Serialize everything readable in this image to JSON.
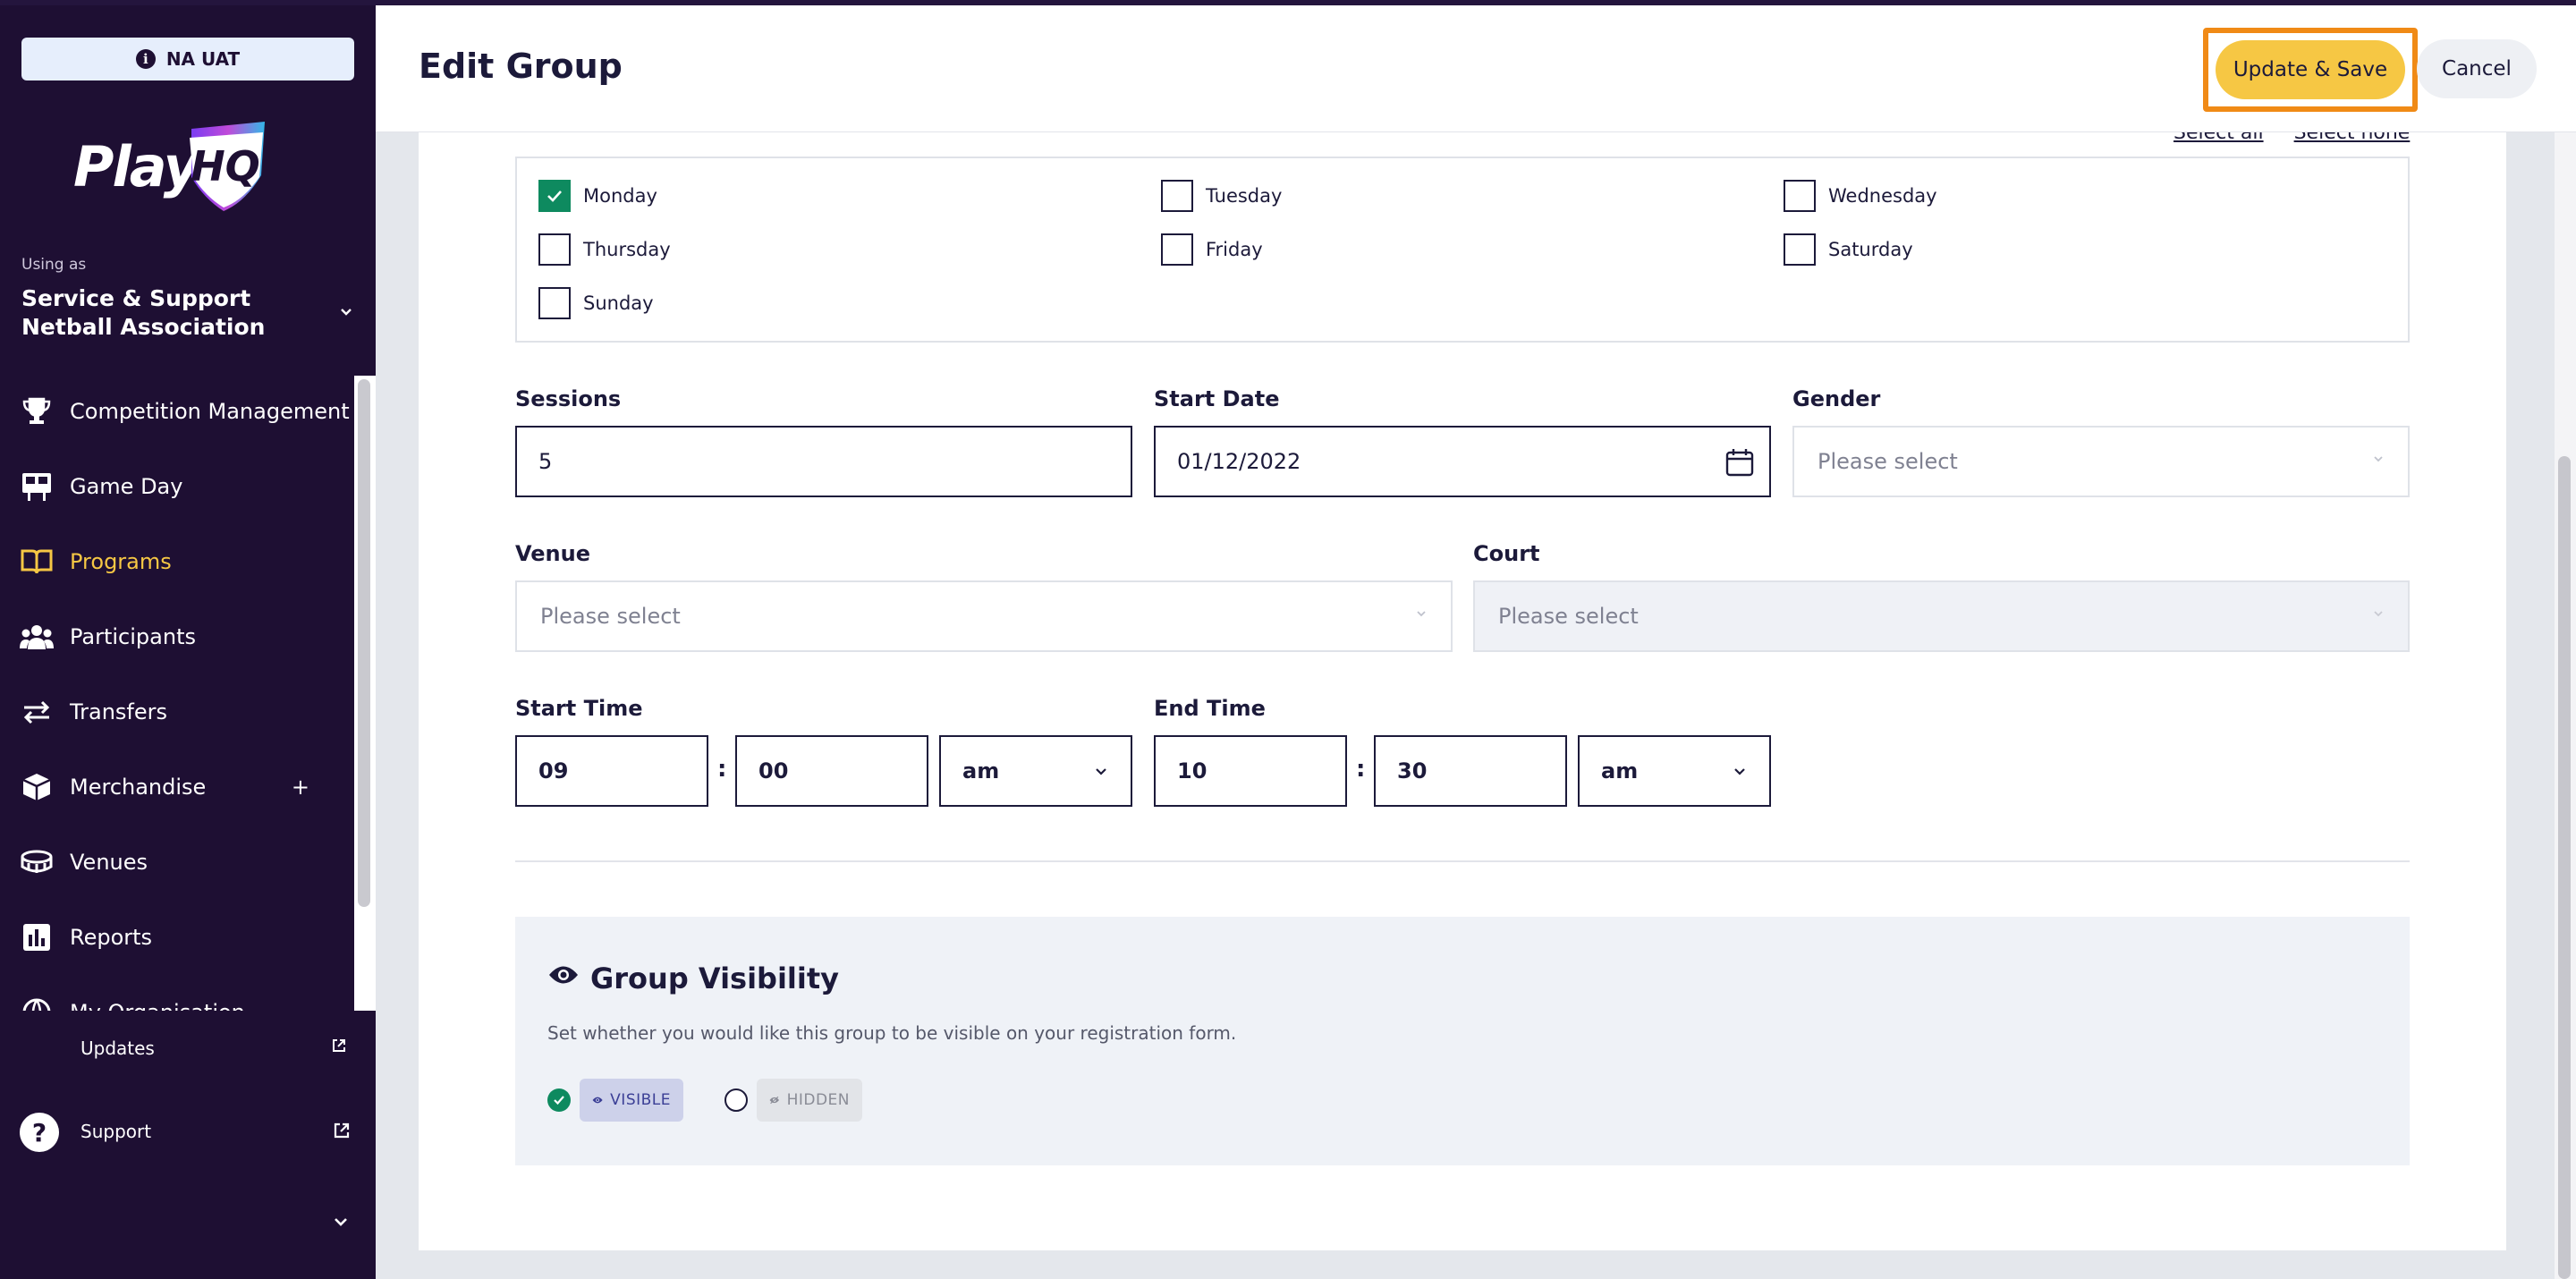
{
  "environment": {
    "badge": "NA UAT"
  },
  "brand": {
    "logo_text": "Play",
    "logo_mark": "HQ"
  },
  "account": {
    "using_as_label": "Using as",
    "org_name": "Service & Support Netball Association"
  },
  "nav": {
    "items": [
      {
        "label": "Competition Management",
        "icon": "trophy-icon"
      },
      {
        "label": "Game Day",
        "icon": "scoreboard-icon"
      },
      {
        "label": "Programs",
        "icon": "book-icon",
        "active": true
      },
      {
        "label": "Participants",
        "icon": "people-icon"
      },
      {
        "label": "Transfers",
        "icon": "arrows-icon"
      },
      {
        "label": "Merchandise",
        "icon": "box-icon",
        "expand": "+"
      },
      {
        "label": "Venues",
        "icon": "stadium-icon"
      },
      {
        "label": "Reports",
        "icon": "chart-icon"
      },
      {
        "label": "My Organisation",
        "icon": "globe-icon"
      }
    ],
    "updates": "Updates",
    "support": "Support"
  },
  "header": {
    "title": "Edit Group",
    "save_label": "Update & Save",
    "cancel_label": "Cancel"
  },
  "days": {
    "select_all": "Select all",
    "select_none": "Select none",
    "items": [
      {
        "label": "Monday",
        "checked": true
      },
      {
        "label": "Tuesday",
        "checked": false
      },
      {
        "label": "Wednesday",
        "checked": false
      },
      {
        "label": "Thursday",
        "checked": false
      },
      {
        "label": "Friday",
        "checked": false
      },
      {
        "label": "Saturday",
        "checked": false
      },
      {
        "label": "Sunday",
        "checked": false
      }
    ]
  },
  "form": {
    "sessions": {
      "label": "Sessions",
      "value": "5"
    },
    "start_date": {
      "label": "Start Date",
      "value": "01/12/2022"
    },
    "gender": {
      "label": "Gender",
      "placeholder": "Please select"
    },
    "venue": {
      "label": "Venue",
      "placeholder": "Please select"
    },
    "court": {
      "label": "Court",
      "placeholder": "Please select"
    },
    "start_time": {
      "label": "Start Time",
      "hour": "09",
      "minute": "00",
      "period": "am"
    },
    "end_time": {
      "label": "End Time",
      "hour": "10",
      "minute": "30",
      "period": "am"
    },
    "time_separator": ":"
  },
  "visibility": {
    "title": "Group Visibility",
    "description": "Set whether you would like this group to be visible on your registration form.",
    "options": [
      {
        "label": "VISIBLE",
        "selected": true
      },
      {
        "label": "HIDDEN",
        "selected": false
      }
    ]
  },
  "colors": {
    "sidebar": "#1e0f33",
    "accent": "#f6c744",
    "highlight": "#f08a16",
    "check": "#0e8a5f"
  }
}
